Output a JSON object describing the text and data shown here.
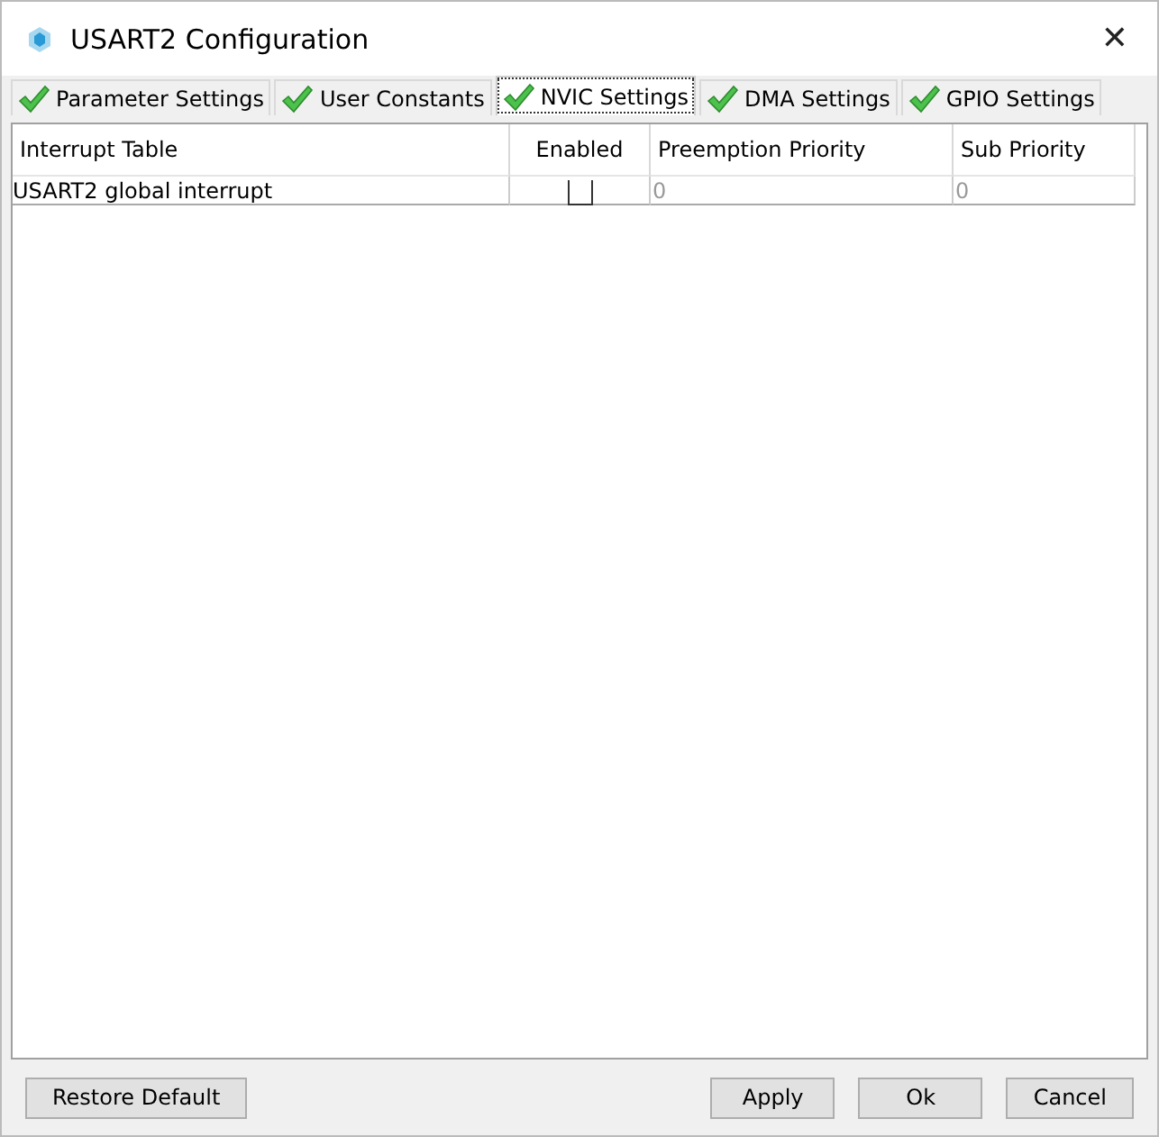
{
  "window": {
    "title": "USART2 Configuration",
    "close": "✕"
  },
  "tabs": [
    {
      "label": "Parameter Settings",
      "selected": false,
      "valid": true
    },
    {
      "label": "User Constants",
      "selected": false,
      "valid": true
    },
    {
      "label": "NVIC Settings",
      "selected": true,
      "valid": true
    },
    {
      "label": "DMA Settings",
      "selected": false,
      "valid": true
    },
    {
      "label": "GPIO Settings",
      "selected": false,
      "valid": true
    }
  ],
  "table": {
    "columns": [
      "Interrupt Table",
      "Enabled",
      "Preemption Priority",
      "Sub Priority"
    ],
    "rows": [
      {
        "name": "USART2 global interrupt",
        "enabled": false,
        "preemption_priority": "0",
        "sub_priority": "0"
      }
    ]
  },
  "buttons": {
    "left": [
      "Restore Default"
    ],
    "right": [
      "Apply",
      "Ok",
      "Cancel"
    ]
  }
}
